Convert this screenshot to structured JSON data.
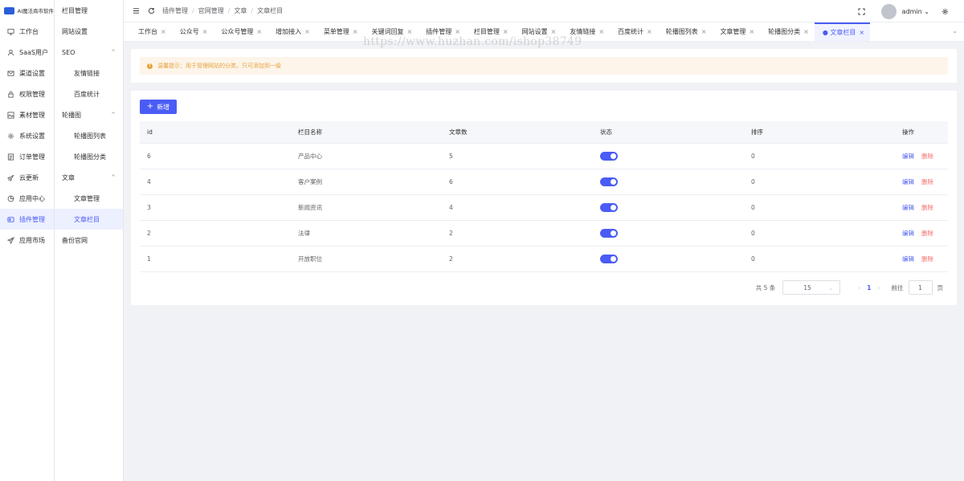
{
  "app": {
    "name": "AI魔法商市软件"
  },
  "rail": {
    "items": [
      {
        "label": "工作台",
        "icon": "monitor-icon"
      },
      {
        "label": "SaaS用户",
        "icon": "user-icon"
      },
      {
        "label": "渠道设置",
        "icon": "mail-icon"
      },
      {
        "label": "权限管理",
        "icon": "lock-icon"
      },
      {
        "label": "素材管理",
        "icon": "image-icon"
      },
      {
        "label": "系统设置",
        "icon": "gear-icon"
      },
      {
        "label": "订单管理",
        "icon": "document-icon"
      },
      {
        "label": "云更新",
        "icon": "rocket-icon"
      },
      {
        "label": "应用中心",
        "icon": "app-icon"
      },
      {
        "label": "插件管理",
        "icon": "plugin-icon"
      },
      {
        "label": "应用市场",
        "icon": "send-icon"
      }
    ]
  },
  "subnav": {
    "items": [
      {
        "label": "栏目管理"
      },
      {
        "label": "网站设置"
      },
      {
        "label": "SEO"
      },
      {
        "label": "友情链接"
      },
      {
        "label": "百度统计"
      },
      {
        "label": "轮播图"
      },
      {
        "label": "轮播图列表"
      },
      {
        "label": "轮播图分类"
      },
      {
        "label": "文章"
      },
      {
        "label": "文章管理"
      },
      {
        "label": "文章栏目"
      },
      {
        "label": "备份官网"
      }
    ]
  },
  "header": {
    "breadcrumb": [
      "插件管理",
      "官网管理",
      "文章",
      "文章栏目"
    ],
    "user": "admin"
  },
  "tabs": [
    {
      "label": "工作台"
    },
    {
      "label": "公众号"
    },
    {
      "label": "公众号管理"
    },
    {
      "label": "增加接入"
    },
    {
      "label": "菜单管理"
    },
    {
      "label": "关键词回复"
    },
    {
      "label": "插件管理"
    },
    {
      "label": "栏目管理"
    },
    {
      "label": "网站设置"
    },
    {
      "label": "友情链接"
    },
    {
      "label": "百度统计"
    },
    {
      "label": "轮播图列表"
    },
    {
      "label": "文章管理"
    },
    {
      "label": "轮播图分类"
    },
    {
      "label": "● 文章栏目"
    }
  ],
  "watermark": "https://www.huzhan.com/ishop38749",
  "notice": {
    "text": "温馨提示：用于管理网站的分类，只可添加到一级"
  },
  "toolbar": {
    "add_label": "新增"
  },
  "table": {
    "columns": [
      "id",
      "栏目名称",
      "文章数",
      "状态",
      "排序",
      "操作"
    ],
    "rows": [
      {
        "id": "6",
        "name": "产品中心",
        "count": "5",
        "status": true,
        "sort": "0"
      },
      {
        "id": "4",
        "name": "客户案例",
        "count": "6",
        "status": true,
        "sort": "0"
      },
      {
        "id": "3",
        "name": "新闻资讯",
        "count": "4",
        "status": true,
        "sort": "0"
      },
      {
        "id": "2",
        "name": "法律",
        "count": "2",
        "status": true,
        "sort": "0"
      },
      {
        "id": "1",
        "name": "开放职位",
        "count": "2",
        "status": true,
        "sort": "0"
      }
    ],
    "actions": {
      "edit": "编辑",
      "delete": "删除"
    }
  },
  "pagination": {
    "total_text": "共 5 条",
    "page_size": "15",
    "current_page": "1",
    "goto_label": "前往",
    "goto_value": "1",
    "page_unit": "页"
  },
  "colors": {
    "primary": "#4a5cf5",
    "danger": "#f56c6c",
    "warning": "#e6a23c"
  }
}
